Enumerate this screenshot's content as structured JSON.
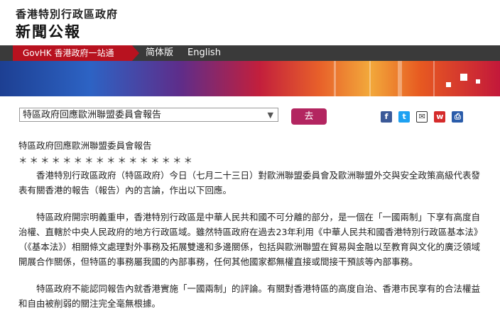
{
  "header": {
    "org": "香港特別行政區政府",
    "title": "新聞公報"
  },
  "nav": {
    "govhk": "GovHK 香港政府一站通",
    "simplified": "简体版",
    "english": "English"
  },
  "toolbar": {
    "select_value": "特區政府回應歐洲聯盟委員會報告",
    "go_label": "去",
    "icons": [
      "facebook-icon",
      "twitter-icon",
      "email-icon",
      "weibo-icon",
      "print-icon"
    ]
  },
  "article": {
    "headline": "特區政府回應歐洲聯盟委員會報告",
    "stars": "＊＊＊＊＊＊＊＊＊＊＊＊＊＊＊＊",
    "paragraphs": [
      "香港特別行政區政府（特區政府）今日（七月二十三日）對歐洲聯盟委員會及歐洲聯盟外交與安全政策高級代表發表有關香港的報告（報告）內的言論，作出以下回應。",
      "特區政府開宗明義重申，香港特別行政區是中華人民共和國不可分離的部分，是一個在「一國兩制」下享有高度自治權、直轄於中央人民政府的地方行政區域。雖然特區政府在過去23年利用《中華人民共和國香港特別行政區基本法》（《基本法》）相關條文處理對外事務及拓展雙邊和多邊關係，包括與歐洲聯盟在貿易與金融以至教育與文化的廣泛領域開展合作關係，但特區的事務屬我國的內部事務，任何其他國家都無權直接或間接干預該等內部事務。",
      "特區政府不能認同報告內就香港實施「一國兩制」的評論。有關對香港特區的高度自治、香港市民享有的合法權益和自由被削弱的關注完全毫無根據。"
    ]
  }
}
